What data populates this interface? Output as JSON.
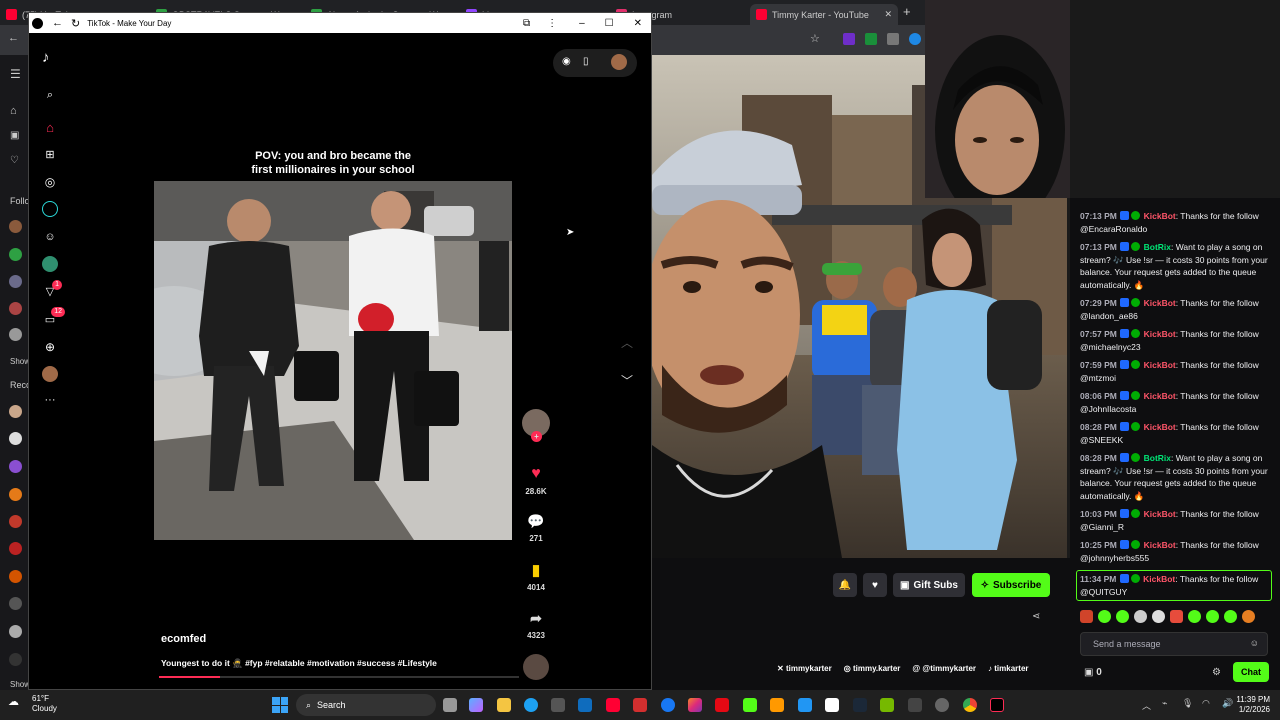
{
  "bg_browser": {
    "tabs": [
      {
        "label": "(75) YouTube",
        "color": "#ff0033"
      },
      {
        "label": "OBSTRAVELS Stream - Wa",
        "color": "#2ea043"
      },
      {
        "label": "Aircon Authority Stream - Wat",
        "color": "#2ea043"
      },
      {
        "label": "Live ...",
        "color": "#9146ff"
      },
      {
        "label": "Instagram",
        "color": "#e1306c"
      },
      {
        "label": "Timmy Karter - YouTube",
        "color": "#ff0033"
      }
    ],
    "sidebar_labels": {
      "follow": "Follo",
      "show1": "Show",
      "rec": "Reco",
      "show2": "Show"
    }
  },
  "tiktok": {
    "window_title": "TikTok - Make Your Day",
    "caption_line1": "POV: you and bro became the",
    "caption_line2": "first millionaires in your school",
    "author": "ecomfed",
    "description": "Youngest to do it 🥷 #fyp #relatable #motivation #success #Lifestyle",
    "likes": "28.6K",
    "comments": "271",
    "saves": "4014",
    "shares": "4323",
    "badges": {
      "activity": "1",
      "inbox": "12"
    },
    "progress": 0.17,
    "colors": {
      "accent": "#fe2c55",
      "save": "#facd00"
    }
  },
  "chat": {
    "messages": [
      {
        "time": "07:13 PM",
        "user": "KickBot",
        "user_color": "#ff5569",
        "text": ": Thanks for the follow @EncaraRonaldo"
      },
      {
        "time": "07:13 PM",
        "user": "BotRix",
        "user_color": "#00e676",
        "text": ": Want to play a song on stream? 🎶 Use !sr — it costs 30 points from your balance. Your request gets added to the queue automatically. 🔥"
      },
      {
        "time": "07:29 PM",
        "user": "KickBot",
        "user_color": "#ff5569",
        "text": ": Thanks for the follow @landon_ae86"
      },
      {
        "time": "07:57 PM",
        "user": "KickBot",
        "user_color": "#ff5569",
        "text": ": Thanks for the follow @michaelnyc23"
      },
      {
        "time": "07:59 PM",
        "user": "KickBot",
        "user_color": "#ff5569",
        "text": ": Thanks for the follow @mtzmoi"
      },
      {
        "time": "08:06 PM",
        "user": "KickBot",
        "user_color": "#ff5569",
        "text": ": Thanks for the follow @JohnIlacosta"
      },
      {
        "time": "08:28 PM",
        "user": "KickBot",
        "user_color": "#ff5569",
        "text": ": Thanks for the follow @SNEEKK"
      },
      {
        "time": "08:28 PM",
        "user": "BotRix",
        "user_color": "#00e676",
        "text": ": Want to play a song on stream? 🎶 Use !sr — it costs 30 points from your balance. Your request gets added to the queue automatically. 🔥"
      },
      {
        "time": "10:03 PM",
        "user": "KickBot",
        "user_color": "#ff5569",
        "text": ": Thanks for the follow @Gianni_R"
      },
      {
        "time": "10:25 PM",
        "user": "KickBot",
        "user_color": "#ff5569",
        "text": ": Thanks for the follow @johnnyherbs555"
      },
      {
        "time": "11:34 PM",
        "user": "KickBot",
        "user_color": "#ff5569",
        "text": ": Thanks for the follow @QUITGUY"
      }
    ],
    "input_placeholder": "Send a message",
    "points": "0",
    "chat_button": "Chat"
  },
  "channel": {
    "gift_subs": "Gift Subs",
    "subscribe": "Subscribe",
    "socials": [
      "timmykarter",
      "timmy.karter",
      "@timmykarter",
      "timkarter"
    ],
    "accent": "#53fc18"
  },
  "taskbar": {
    "temp": "61°F",
    "weather": "Cloudy",
    "search": "Search",
    "time": "11:39 PM",
    "date": "1/2/2026"
  }
}
